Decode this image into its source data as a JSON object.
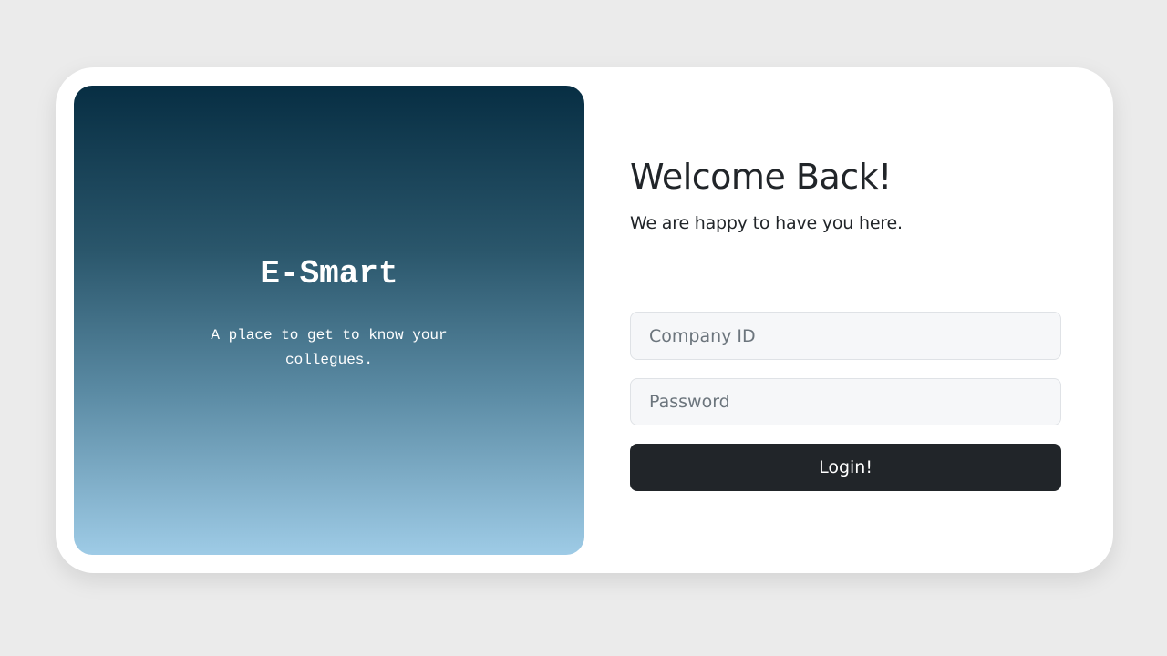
{
  "hero": {
    "brand": "E-Smart",
    "tagline": "A place to get to know your collegues."
  },
  "form": {
    "title": "Welcome Back!",
    "subtitle": "We are happy to have you here.",
    "company_id": {
      "value": "",
      "placeholder": "Company ID"
    },
    "password": {
      "value": "",
      "placeholder": "Password"
    },
    "login_label": "Login!"
  },
  "colors": {
    "background": "#ebebeb",
    "card": "#ffffff",
    "gradient_top": "#072e43",
    "gradient_bottom": "#9ecbe6",
    "button": "#212529",
    "input_bg": "#f6f7f9"
  }
}
